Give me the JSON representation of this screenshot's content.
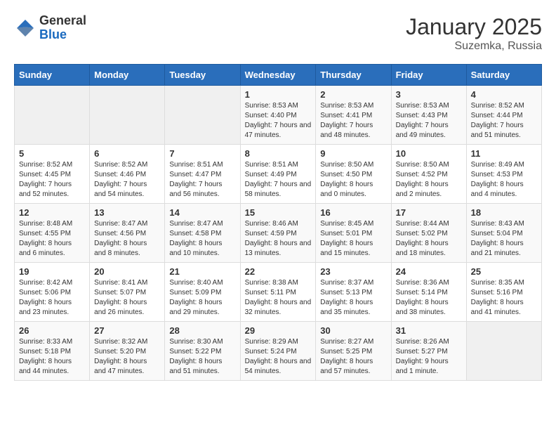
{
  "header": {
    "logo_general": "General",
    "logo_blue": "Blue",
    "month_title": "January 2025",
    "location": "Suzemka, Russia"
  },
  "weekdays": [
    "Sunday",
    "Monday",
    "Tuesday",
    "Wednesday",
    "Thursday",
    "Friday",
    "Saturday"
  ],
  "weeks": [
    [
      {
        "day": "",
        "info": ""
      },
      {
        "day": "",
        "info": ""
      },
      {
        "day": "",
        "info": ""
      },
      {
        "day": "1",
        "info": "Sunrise: 8:53 AM\nSunset: 4:40 PM\nDaylight: 7 hours and 47 minutes."
      },
      {
        "day": "2",
        "info": "Sunrise: 8:53 AM\nSunset: 4:41 PM\nDaylight: 7 hours and 48 minutes."
      },
      {
        "day": "3",
        "info": "Sunrise: 8:53 AM\nSunset: 4:43 PM\nDaylight: 7 hours and 49 minutes."
      },
      {
        "day": "4",
        "info": "Sunrise: 8:52 AM\nSunset: 4:44 PM\nDaylight: 7 hours and 51 minutes."
      }
    ],
    [
      {
        "day": "5",
        "info": "Sunrise: 8:52 AM\nSunset: 4:45 PM\nDaylight: 7 hours and 52 minutes."
      },
      {
        "day": "6",
        "info": "Sunrise: 8:52 AM\nSunset: 4:46 PM\nDaylight: 7 hours and 54 minutes."
      },
      {
        "day": "7",
        "info": "Sunrise: 8:51 AM\nSunset: 4:47 PM\nDaylight: 7 hours and 56 minutes."
      },
      {
        "day": "8",
        "info": "Sunrise: 8:51 AM\nSunset: 4:49 PM\nDaylight: 7 hours and 58 minutes."
      },
      {
        "day": "9",
        "info": "Sunrise: 8:50 AM\nSunset: 4:50 PM\nDaylight: 8 hours and 0 minutes."
      },
      {
        "day": "10",
        "info": "Sunrise: 8:50 AM\nSunset: 4:52 PM\nDaylight: 8 hours and 2 minutes."
      },
      {
        "day": "11",
        "info": "Sunrise: 8:49 AM\nSunset: 4:53 PM\nDaylight: 8 hours and 4 minutes."
      }
    ],
    [
      {
        "day": "12",
        "info": "Sunrise: 8:48 AM\nSunset: 4:55 PM\nDaylight: 8 hours and 6 minutes."
      },
      {
        "day": "13",
        "info": "Sunrise: 8:47 AM\nSunset: 4:56 PM\nDaylight: 8 hours and 8 minutes."
      },
      {
        "day": "14",
        "info": "Sunrise: 8:47 AM\nSunset: 4:58 PM\nDaylight: 8 hours and 10 minutes."
      },
      {
        "day": "15",
        "info": "Sunrise: 8:46 AM\nSunset: 4:59 PM\nDaylight: 8 hours and 13 minutes."
      },
      {
        "day": "16",
        "info": "Sunrise: 8:45 AM\nSunset: 5:01 PM\nDaylight: 8 hours and 15 minutes."
      },
      {
        "day": "17",
        "info": "Sunrise: 8:44 AM\nSunset: 5:02 PM\nDaylight: 8 hours and 18 minutes."
      },
      {
        "day": "18",
        "info": "Sunrise: 8:43 AM\nSunset: 5:04 PM\nDaylight: 8 hours and 21 minutes."
      }
    ],
    [
      {
        "day": "19",
        "info": "Sunrise: 8:42 AM\nSunset: 5:06 PM\nDaylight: 8 hours and 23 minutes."
      },
      {
        "day": "20",
        "info": "Sunrise: 8:41 AM\nSunset: 5:07 PM\nDaylight: 8 hours and 26 minutes."
      },
      {
        "day": "21",
        "info": "Sunrise: 8:40 AM\nSunset: 5:09 PM\nDaylight: 8 hours and 29 minutes."
      },
      {
        "day": "22",
        "info": "Sunrise: 8:38 AM\nSunset: 5:11 PM\nDaylight: 8 hours and 32 minutes."
      },
      {
        "day": "23",
        "info": "Sunrise: 8:37 AM\nSunset: 5:13 PM\nDaylight: 8 hours and 35 minutes."
      },
      {
        "day": "24",
        "info": "Sunrise: 8:36 AM\nSunset: 5:14 PM\nDaylight: 8 hours and 38 minutes."
      },
      {
        "day": "25",
        "info": "Sunrise: 8:35 AM\nSunset: 5:16 PM\nDaylight: 8 hours and 41 minutes."
      }
    ],
    [
      {
        "day": "26",
        "info": "Sunrise: 8:33 AM\nSunset: 5:18 PM\nDaylight: 8 hours and 44 minutes."
      },
      {
        "day": "27",
        "info": "Sunrise: 8:32 AM\nSunset: 5:20 PM\nDaylight: 8 hours and 47 minutes."
      },
      {
        "day": "28",
        "info": "Sunrise: 8:30 AM\nSunset: 5:22 PM\nDaylight: 8 hours and 51 minutes."
      },
      {
        "day": "29",
        "info": "Sunrise: 8:29 AM\nSunset: 5:24 PM\nDaylight: 8 hours and 54 minutes."
      },
      {
        "day": "30",
        "info": "Sunrise: 8:27 AM\nSunset: 5:25 PM\nDaylight: 8 hours and 57 minutes."
      },
      {
        "day": "31",
        "info": "Sunrise: 8:26 AM\nSunset: 5:27 PM\nDaylight: 9 hours and 1 minute."
      },
      {
        "day": "",
        "info": ""
      }
    ]
  ]
}
